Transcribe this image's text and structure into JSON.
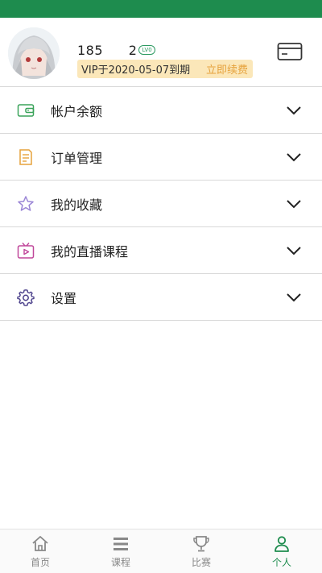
{
  "profile": {
    "username": "185         2",
    "level_badge": "LV0",
    "vip_text": "VIP于2020-05-07到期",
    "renew_label": "立即续费"
  },
  "menu": {
    "items": [
      {
        "label": "帐户余额",
        "icon": "wallet-icon",
        "color": "#3aa35a"
      },
      {
        "label": "订单管理",
        "icon": "order-list-icon",
        "color": "#e6a23c"
      },
      {
        "label": "我的收藏",
        "icon": "star-icon",
        "color": "#9b86d6"
      },
      {
        "label": "我的直播课程",
        "icon": "tv-icon",
        "color": "#c0479a"
      },
      {
        "label": "设置",
        "icon": "gear-icon",
        "color": "#4a3f8a"
      }
    ]
  },
  "tabbar": {
    "tabs": [
      {
        "label": "首页",
        "icon": "home-icon"
      },
      {
        "label": "课程",
        "icon": "list-icon"
      },
      {
        "label": "比赛",
        "icon": "trophy-icon"
      },
      {
        "label": "个人",
        "icon": "person-icon",
        "active": true
      }
    ]
  },
  "colors": {
    "brand": "#1e8c4e",
    "vip_bg": "#fbe7b9",
    "renew": "#e6a23c"
  }
}
